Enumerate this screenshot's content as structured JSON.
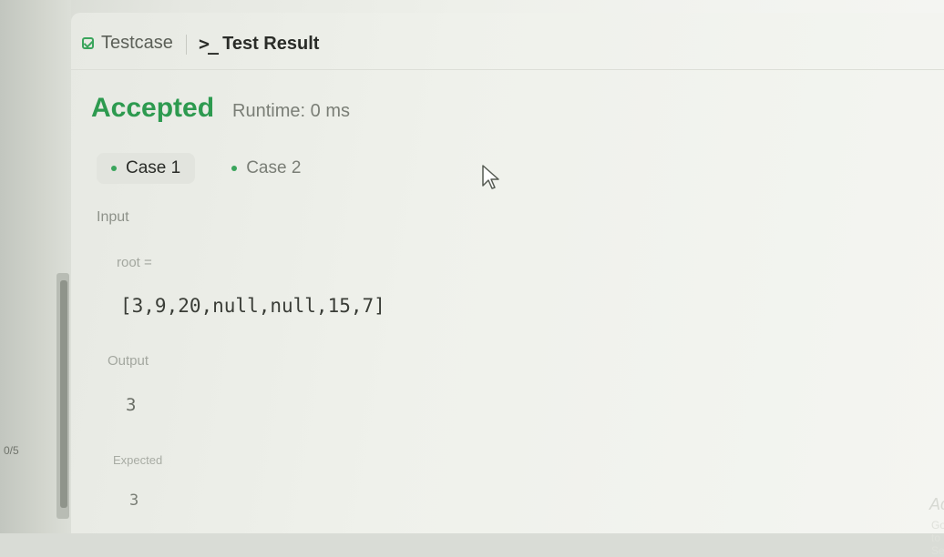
{
  "tabs": {
    "testcase_label": "Testcase",
    "result_label": "Test Result"
  },
  "result": {
    "status": "Accepted",
    "runtime": "Runtime: 0 ms"
  },
  "cases": [
    {
      "label": "Case 1",
      "active": true
    },
    {
      "label": "Case 2",
      "active": false
    }
  ],
  "input": {
    "section_label": "Input",
    "var_name": "root =",
    "var_value": "[3,9,20,null,null,15,7]"
  },
  "output": {
    "label": "Output",
    "value": "3"
  },
  "expected": {
    "label": "Expected",
    "value": "3"
  },
  "side": {
    "counter": "0/5"
  },
  "watermark": {
    "title": "Activate",
    "subtitle": "Go to Setti"
  },
  "colors": {
    "accepted": "#2d9a4f",
    "dot": "#3aa55c"
  },
  "icons": {
    "testcase": "checkbox-icon",
    "result": "terminal-icon",
    "case": "dot-icon",
    "pointer": "mouse-cursor-icon"
  }
}
